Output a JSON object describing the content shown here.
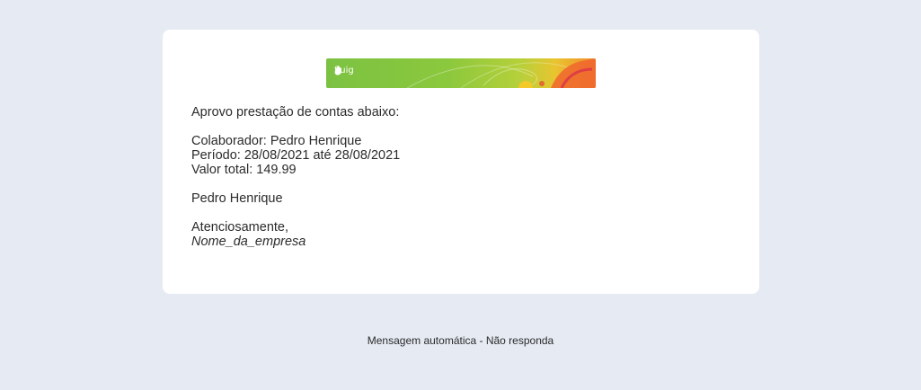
{
  "banner": {
    "brand": "fluig",
    "logo_icon": "fluig-leaf-icon"
  },
  "message": {
    "intro": "Aprovo prestação de contas abaixo:",
    "colaborador": "Colaborador: Pedro Henrique",
    "periodo": "Período: 28/08/2021 até 28/08/2021",
    "valor_total": "Valor total: 149.99",
    "name": "Pedro Henrique",
    "closing": "Atenciosamente,",
    "company": "Nome_da_empresa"
  },
  "footer": {
    "text": "Mensagem automática - Não responda"
  },
  "colors": {
    "page_background": "#e5eaf3",
    "card_background": "#ffffff",
    "banner_green": "#7cc242",
    "banner_orange": "#f28a2c"
  }
}
